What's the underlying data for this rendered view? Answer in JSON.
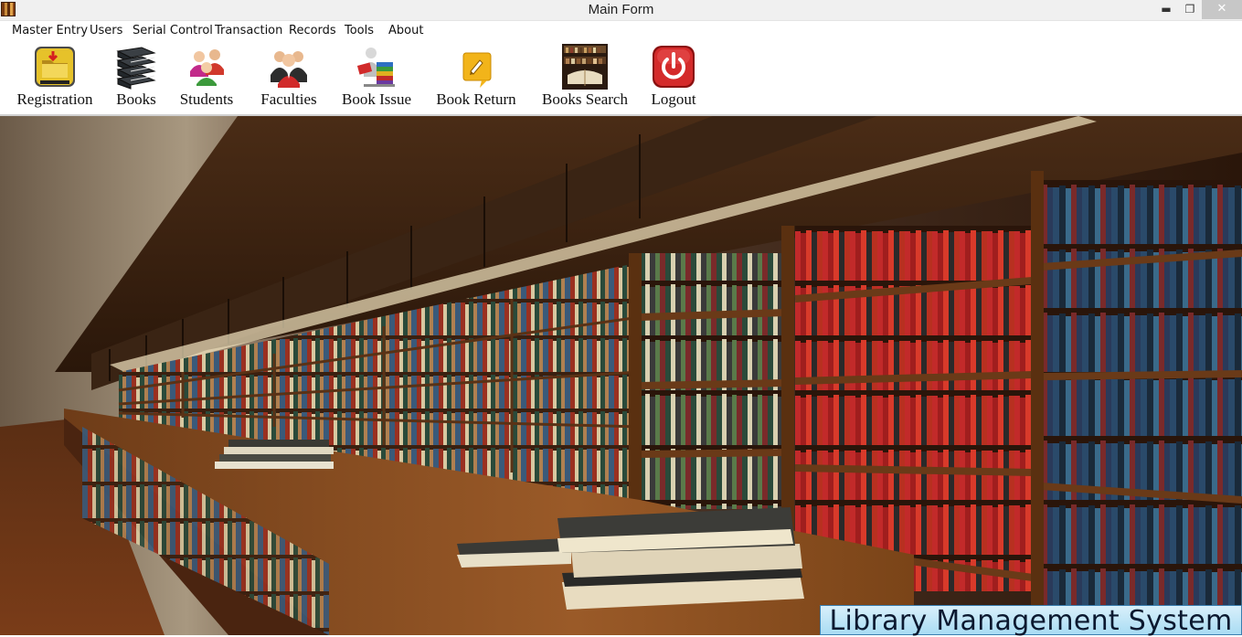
{
  "window": {
    "title": "Main Form",
    "controls": {
      "minimize": "▬",
      "restore": "❐",
      "close": "✕"
    }
  },
  "menu": {
    "items": [
      "Master Entry",
      "Users",
      "Serial Control",
      "Transaction",
      "Records",
      "Tools",
      "About"
    ]
  },
  "toolbar": {
    "items": [
      {
        "label": "Registration",
        "icon": "registration-folder-icon"
      },
      {
        "label": "Books",
        "icon": "books-stack-icon"
      },
      {
        "label": "Students",
        "icon": "students-icon"
      },
      {
        "label": "Faculties",
        "icon": "faculties-icon"
      },
      {
        "label": "Book Issue",
        "icon": "book-issue-icon"
      },
      {
        "label": "Book Return",
        "icon": "book-return-icon"
      },
      {
        "label": "Books Search",
        "icon": "books-search-icon"
      },
      {
        "label": "Logout",
        "icon": "power-icon"
      }
    ]
  },
  "banner": {
    "text": "Library Management System"
  },
  "colors": {
    "logout_red": "#d42a2a",
    "registration_yellow": "#e6c22a",
    "banner_bg": "#bfe6f7"
  }
}
